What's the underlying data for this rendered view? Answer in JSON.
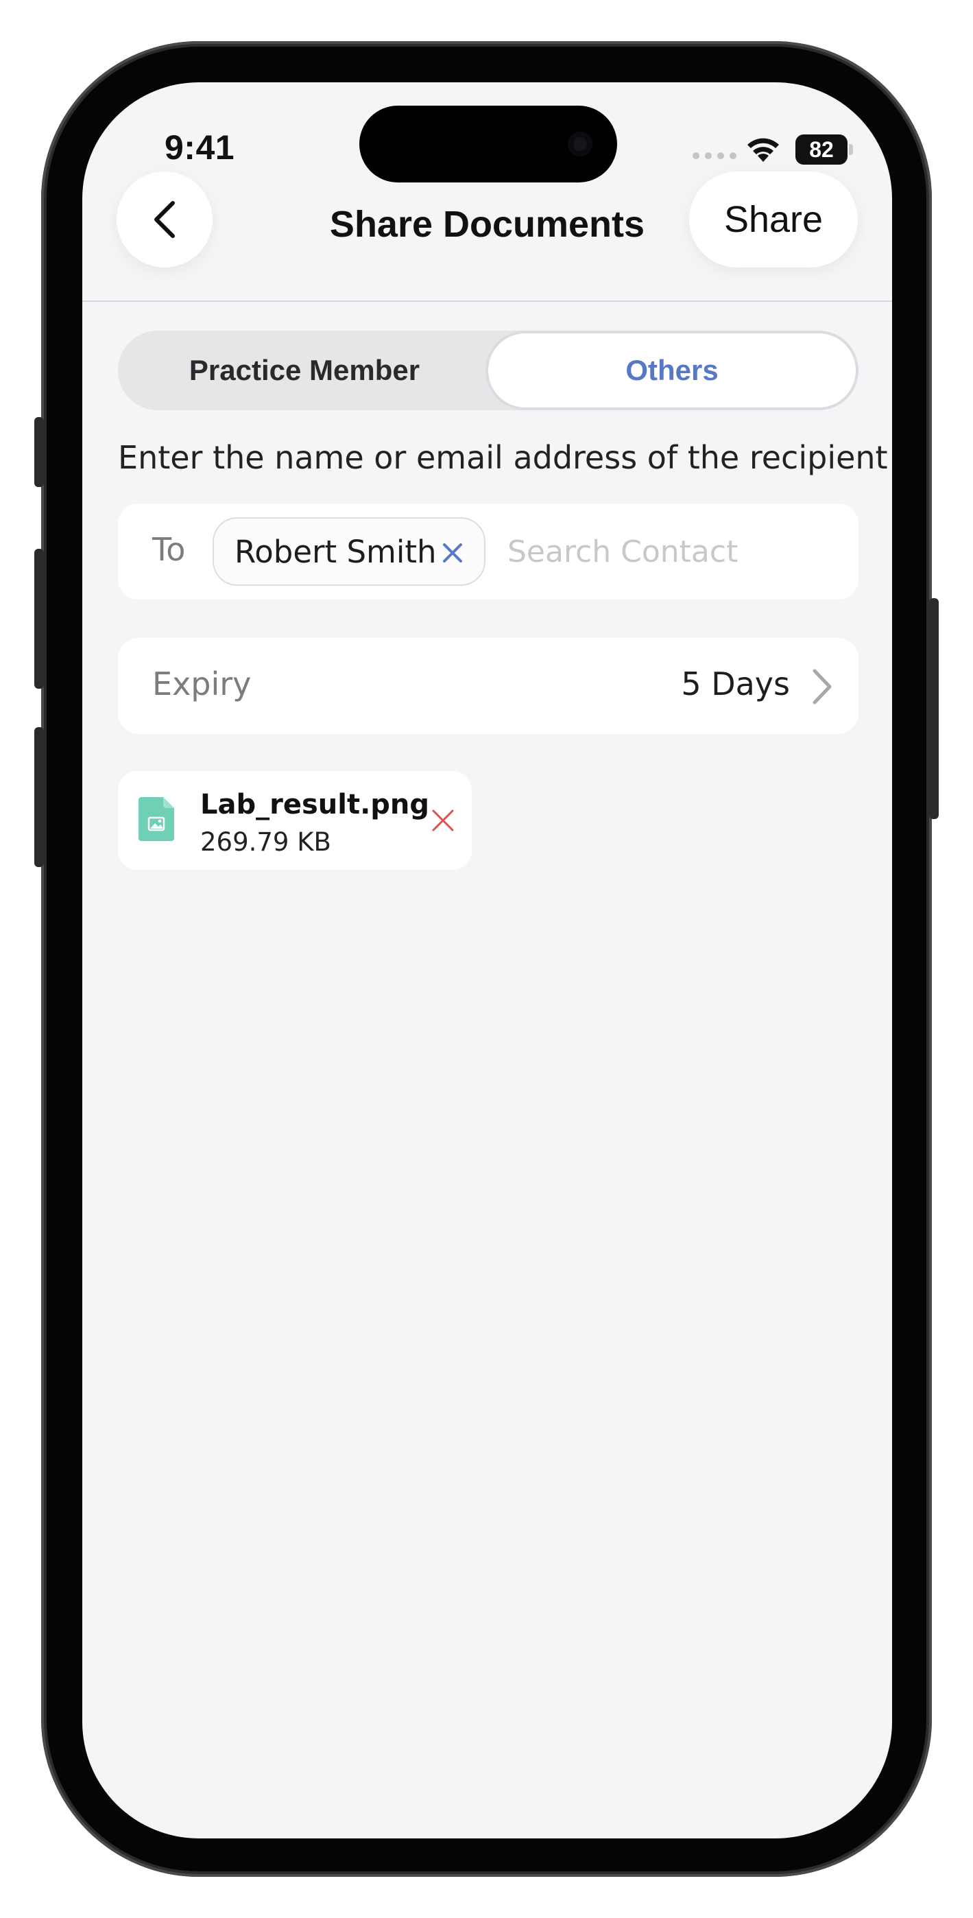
{
  "status_bar": {
    "time": "9:41",
    "battery": "82"
  },
  "header": {
    "title": "Share Documents",
    "back_icon": "chevron-left-icon",
    "share_label": "Share"
  },
  "segmented": {
    "tabs": [
      {
        "label": "Practice Member",
        "active": false
      },
      {
        "label": "Others",
        "active": true
      }
    ]
  },
  "instruction": "Enter the name or email address of the recipient",
  "recipient": {
    "to_label": "To",
    "chips": [
      {
        "label": "Robert Smith"
      }
    ],
    "search_placeholder": "Search Contact",
    "search_value": ""
  },
  "expiry": {
    "label": "Expiry",
    "value": "5 Days"
  },
  "attachments": [
    {
      "name": "Lab_result.png",
      "size": "269.79 KB",
      "icon": "image-file-icon"
    }
  ],
  "colors": {
    "accent": "#5678c7",
    "background": "#f5f5f7",
    "file_icon": "#6fd0b5",
    "remove": "#e05252"
  }
}
